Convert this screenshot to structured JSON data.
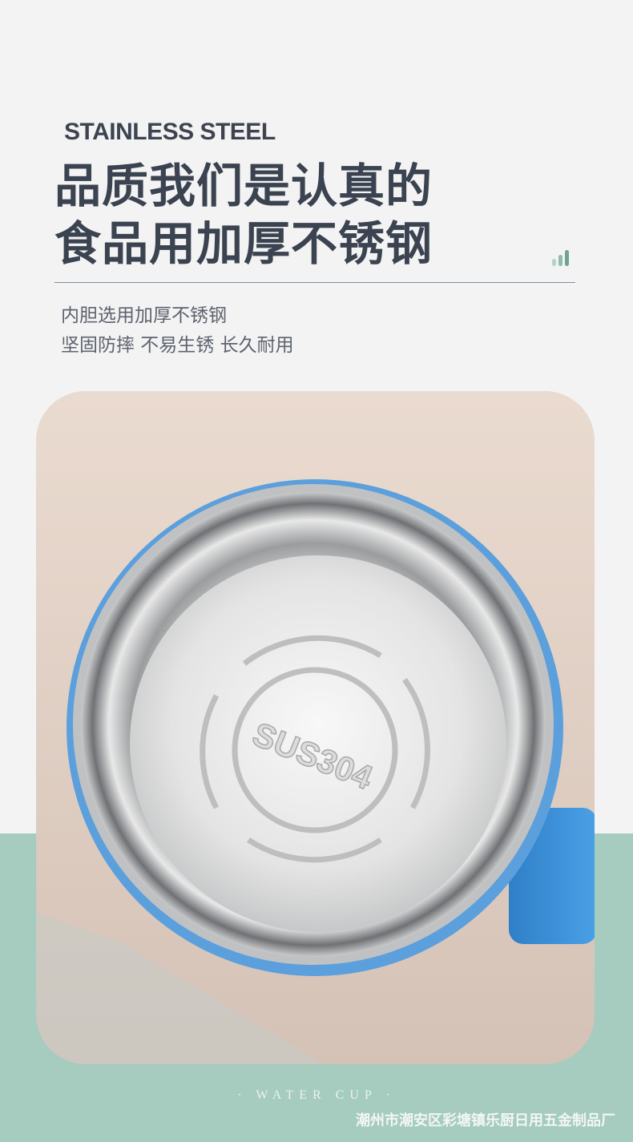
{
  "header": {
    "eyebrow": "STAINLESS STEEL",
    "headline_line1": "品质我们是认真的",
    "headline_line2": "食品用加厚不锈钢",
    "desc_line1": "内胆选用加厚不锈钢",
    "desc_line2": "坚固防摔 不易生锈 长久耐用"
  },
  "photo": {
    "stamp_text": "SUS304",
    "cup_color": "#3e8fd6"
  },
  "footer": {
    "tagline": "· WATER CUP ·",
    "watermark": "潮州市潮安区彩塘镇乐厨日用五金制品厂"
  },
  "colors": {
    "background": "#f3f3f4",
    "accent_green": "#a6cbbf",
    "text_dark": "#3b4350"
  },
  "icons": [
    "signal-bars-icon"
  ]
}
